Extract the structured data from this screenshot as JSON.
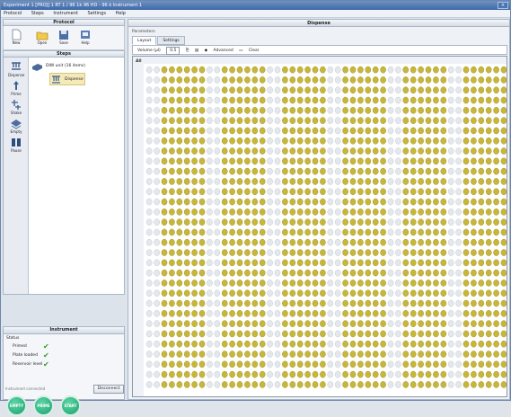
{
  "window": {
    "title": "Experiment 1 [PROJ] 1 RT 1 / 96 1k 96 HD - 96 k Instrument 1"
  },
  "menu": [
    "Protocol",
    "Steps",
    "Instrument",
    "Settings",
    "Help"
  ],
  "protocol_panel": {
    "title": "Protocol",
    "toolbar": [
      {
        "label": "New",
        "icon": "new-document-icon"
      },
      {
        "label": "Open",
        "icon": "open-folder-icon"
      },
      {
        "label": "Save",
        "icon": "save-icon"
      },
      {
        "label": "Help",
        "icon": "help-icon"
      }
    ]
  },
  "steps_panel": {
    "title": "Steps",
    "tools": [
      {
        "label": "Dispense",
        "icon": "dispense-icon"
      },
      {
        "label": "Prime",
        "icon": "prime-icon"
      },
      {
        "label": "Shake",
        "icon": "shake-icon"
      },
      {
        "label": "Empty",
        "icon": "empty-icon"
      },
      {
        "label": "Pause",
        "icon": "pause-icon"
      }
    ],
    "tree": {
      "root": "DIW unit (16 items)",
      "child": "Dispense"
    }
  },
  "instrument_panel": {
    "title": "Instrument",
    "status_label": "Status",
    "items": [
      {
        "label": "Primed",
        "ok": true
      },
      {
        "label": "Plate loaded",
        "ok": true
      },
      {
        "label": "Reservoir level",
        "ok": true
      }
    ],
    "disconnect_hint": "Instrument connected",
    "disconnect_label": "Disconnect",
    "run_buttons": [
      "EMPTY",
      "PRIME",
      "START"
    ]
  },
  "dispense_panel": {
    "title": "Dispense",
    "section_label": "Parameters",
    "tabs": [
      "Layout",
      "Settings"
    ],
    "grid_toolbar": {
      "volume_label": "Volume (µl)",
      "volume_value": "0.5",
      "advanced_label": "Advanced",
      "clear_label": "Clear"
    },
    "grid_corner": "All",
    "colors": {
      "filled": "#c6b63a",
      "empty": "#e4e8ec",
      "accent": "#f2c36a"
    }
  }
}
